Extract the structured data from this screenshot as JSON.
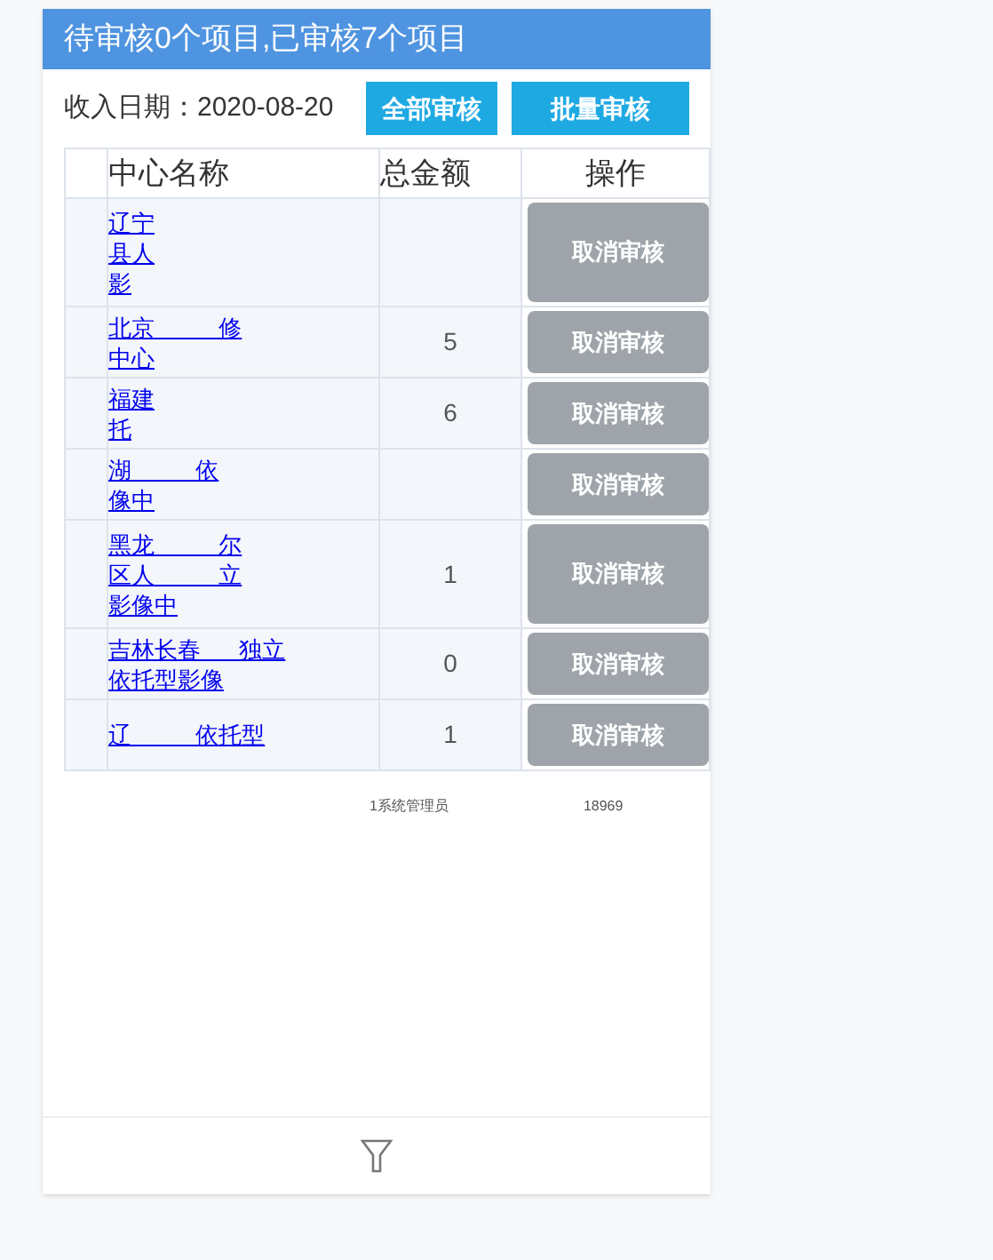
{
  "header": {
    "title": "待审核0个项目,已审核7个项目"
  },
  "toolbar": {
    "date_label": "收入日期：2020-08-20",
    "buttons": [
      "全部审核",
      "批量审核"
    ]
  },
  "table": {
    "columns": [
      "",
      "中心名称",
      "总金额",
      "操作"
    ],
    "rows": [
      {
        "name_lines": [
          "辽宁",
          "县人",
          "影"
        ],
        "amount": "",
        "action": "取消审核"
      },
      {
        "name_lines": [
          "北京          修",
          "中心"
        ],
        "amount": "5",
        "action": "取消审核"
      },
      {
        "name_lines": [
          "福建",
          "托"
        ],
        "amount": "6",
        "action": "取消审核"
      },
      {
        "name_lines": [
          "湖          依",
          "像中"
        ],
        "amount": "",
        "action": "取消审核"
      },
      {
        "name_lines": [
          "黑龙          尔",
          "区人          立",
          "影像中"
        ],
        "amount": "1",
        "action": "取消审核"
      },
      {
        "name_lines": [
          "吉林长春      独立",
          "依托型影像"
        ],
        "amount": "0",
        "action": "取消审核"
      },
      {
        "name_lines": [
          "辽          依托型"
        ],
        "amount": "1",
        "action": "取消审核"
      }
    ]
  },
  "footer_row": {
    "operator": "1系统管理员",
    "phone": "18969"
  }
}
